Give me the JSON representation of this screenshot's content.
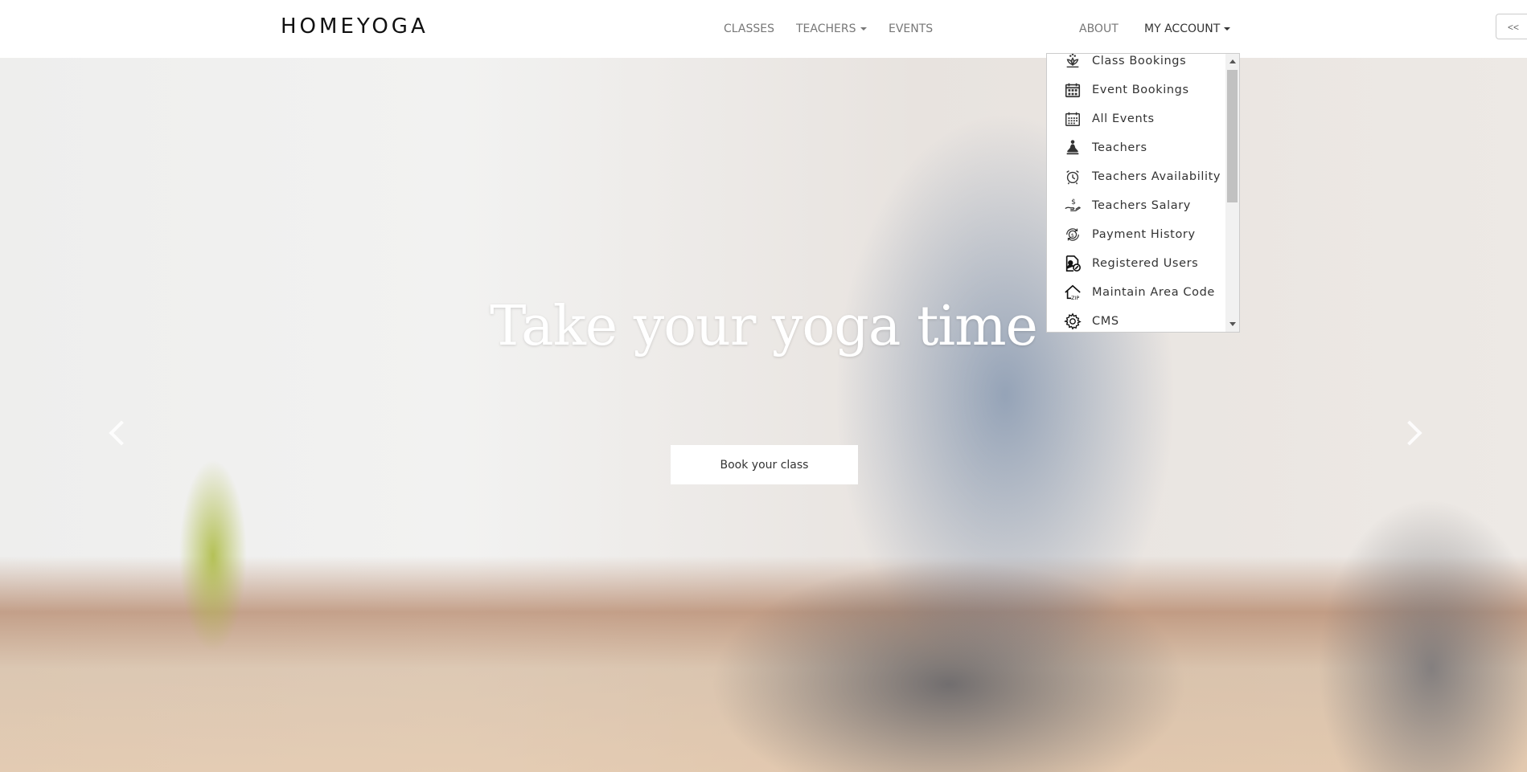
{
  "header": {
    "logo": "HOMEYOGA",
    "nav": [
      {
        "label": "CLASSES",
        "has_caret": false
      },
      {
        "label": "TEACHERS",
        "has_caret": true
      },
      {
        "label": "EVENTS",
        "has_caret": false
      },
      {
        "label": "ABOUT",
        "has_caret": false
      },
      {
        "label": "MY ACCOUNT",
        "has_caret": true
      }
    ],
    "collapse_button": "<<"
  },
  "account_menu": {
    "items": [
      {
        "label": "Class Bookings",
        "icon": "lotus-icon"
      },
      {
        "label": "Event Bookings",
        "icon": "calendar-icon"
      },
      {
        "label": "All Events",
        "icon": "calendar-grid-icon"
      },
      {
        "label": "Teachers",
        "icon": "meditation-icon"
      },
      {
        "label": "Teachers Availability",
        "icon": "alarm-clock-icon"
      },
      {
        "label": "Teachers Salary",
        "icon": "hand-dollar-icon"
      },
      {
        "label": "Payment History",
        "icon": "payment-cycle-icon"
      },
      {
        "label": "Registered Users",
        "icon": "user-file-icon"
      },
      {
        "label": "Maintain Area Code",
        "icon": "zip-house-icon"
      },
      {
        "label": "CMS",
        "icon": "gear-icon"
      }
    ]
  },
  "hero": {
    "title": "Take your yoga time",
    "cta": "Book your class"
  }
}
